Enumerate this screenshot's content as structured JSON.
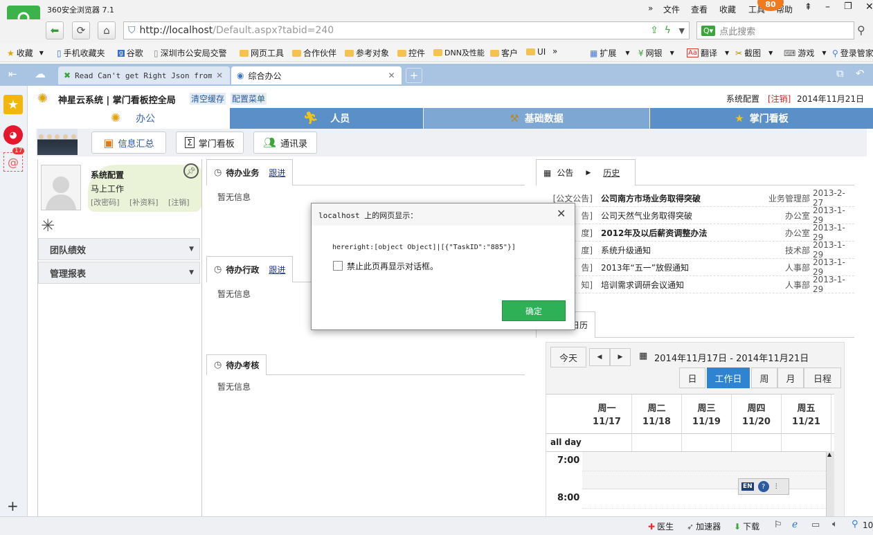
{
  "browser": {
    "app_title": "360安全浏览器 7.1",
    "menu": [
      "文件",
      "查看",
      "收藏",
      "工具",
      "帮助"
    ],
    "badge_count": "80",
    "url_host": "http://localhost",
    "url_path": "/Default.aspx?tabid=240",
    "search_placeholder": "点此搜索",
    "bookmarks": [
      "收藏",
      "手机收藏夹",
      "谷歌",
      "深圳市公安局交警",
      "网页工具",
      "合作伙伴",
      "参考对象",
      "控件",
      "DNN及性能",
      "客户",
      "UI"
    ],
    "bookmark_tools": [
      "扩展",
      "网银",
      "翻译",
      "截图",
      "游戏",
      "登录管家"
    ],
    "tabs": [
      {
        "label": "Read Can't get Right Json from S",
        "active": false
      },
      {
        "label": "综合办公",
        "active": true
      }
    ],
    "rail_mail_count": "17",
    "status": [
      "医生",
      "加速器",
      "下载"
    ],
    "zoom": "10"
  },
  "header": {
    "brand": "神星云系统 | 掌门看板控全局",
    "clear_cache": "清空缓存",
    "config_menu": "配置菜单",
    "sys_config": "系统配置",
    "logout": "[注销]",
    "date": "2014年11月21日"
  },
  "mainnav": [
    "办公",
    "人员",
    "基础数据",
    "掌门看板"
  ],
  "subnav": [
    "信息汇总",
    "掌门看板",
    "通讯录"
  ],
  "user": {
    "name": "系统配置",
    "status": "马上工作",
    "links": [
      "[改密码]",
      "[补资料]",
      "[注销]"
    ]
  },
  "sidebar_menu": [
    "团队绩效",
    "管理报表"
  ],
  "panels": [
    {
      "title": "待办业务",
      "link": "跟进",
      "empty": "暂无信息"
    },
    {
      "title": "待办行政",
      "link": "跟进",
      "empty": "暂无信息"
    },
    {
      "title": "待办考核",
      "link": "",
      "empty": "暂无信息"
    }
  ],
  "announcements": {
    "tab": "公告",
    "history": "历史",
    "rows": [
      {
        "cat": "[公文公告]",
        "title": "公司南方市场业务取得突破",
        "bold": true,
        "dept": "业务管理部",
        "date": "2013-2-27"
      },
      {
        "cat": "告]",
        "title": "公司天然气业务取得突破",
        "bold": false,
        "dept": "办公室",
        "date": "2013-1-29"
      },
      {
        "cat": "度]",
        "title": "2012年及以后薪资调整办法",
        "bold": true,
        "dept": "办公室",
        "date": "2013-1-29"
      },
      {
        "cat": "度]",
        "title": "系统升级通知",
        "bold": false,
        "dept": "技术部",
        "date": "2013-1-29"
      },
      {
        "cat": "告]",
        "title": "2013年“五一”放假通知",
        "bold": false,
        "dept": "人事部",
        "date": "2013-1-29"
      },
      {
        "cat": "知]",
        "title": "培训需求调研会议通知",
        "bold": false,
        "dept": "人事部",
        "date": "2013-1-29"
      }
    ]
  },
  "calendar": {
    "tab": "日历",
    "today": "今天",
    "range": "2014年11月17日 - 2014年11月21日",
    "views": [
      "日",
      "工作日",
      "周",
      "月",
      "日程"
    ],
    "active_view": "工作日",
    "days": [
      {
        "name": "周一",
        "date": "11/17"
      },
      {
        "name": "周二",
        "date": "11/18"
      },
      {
        "name": "周三",
        "date": "11/19"
      },
      {
        "name": "周四",
        "date": "11/20"
      },
      {
        "name": "周五",
        "date": "11/21"
      }
    ],
    "allday": "all day",
    "times": [
      "7:00",
      "8:00"
    ]
  },
  "ime": {
    "lang": "EN"
  },
  "dialog": {
    "title": "localhost 上的网页显示：",
    "message": "hereright:[object Object]|[{\"TaskID\":\"885\"}]",
    "checkbox_label": "禁止此页再显示对话框。",
    "ok": "确定"
  },
  "colors": {
    "nav_active": "#7fa7d3",
    "nav_dark": "#5b8fc8",
    "ok_green": "#2db056",
    "tab_bar": "#a9c4e2"
  }
}
